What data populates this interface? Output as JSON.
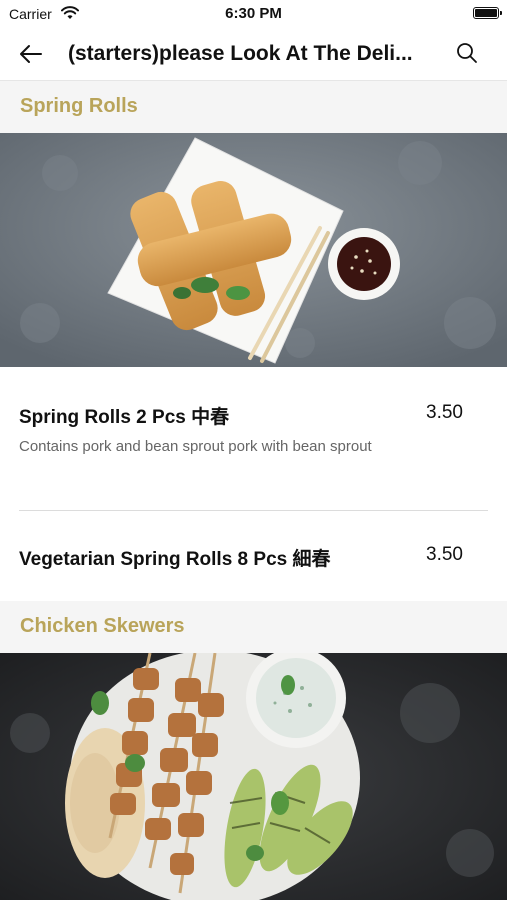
{
  "status_bar": {
    "carrier": "Carrier",
    "time": "6:30 PM"
  },
  "nav": {
    "title": "(starters)please Look At The Deli..."
  },
  "sections": [
    {
      "title": "Spring Rolls",
      "items": [
        {
          "name": "Spring Rolls 2 Pcs 中春",
          "price": "3.50",
          "description": "Contains pork  and bean sprout pork with bean sprout"
        },
        {
          "name": "Vegetarian Spring Rolls 8 Pcs 細春",
          "price": "3.50"
        }
      ]
    },
    {
      "title": "Chicken Skewers"
    }
  ],
  "colors": {
    "accent": "#b9a45a",
    "section_bg": "#f5f5f5",
    "divider": "#dcdcdc"
  }
}
